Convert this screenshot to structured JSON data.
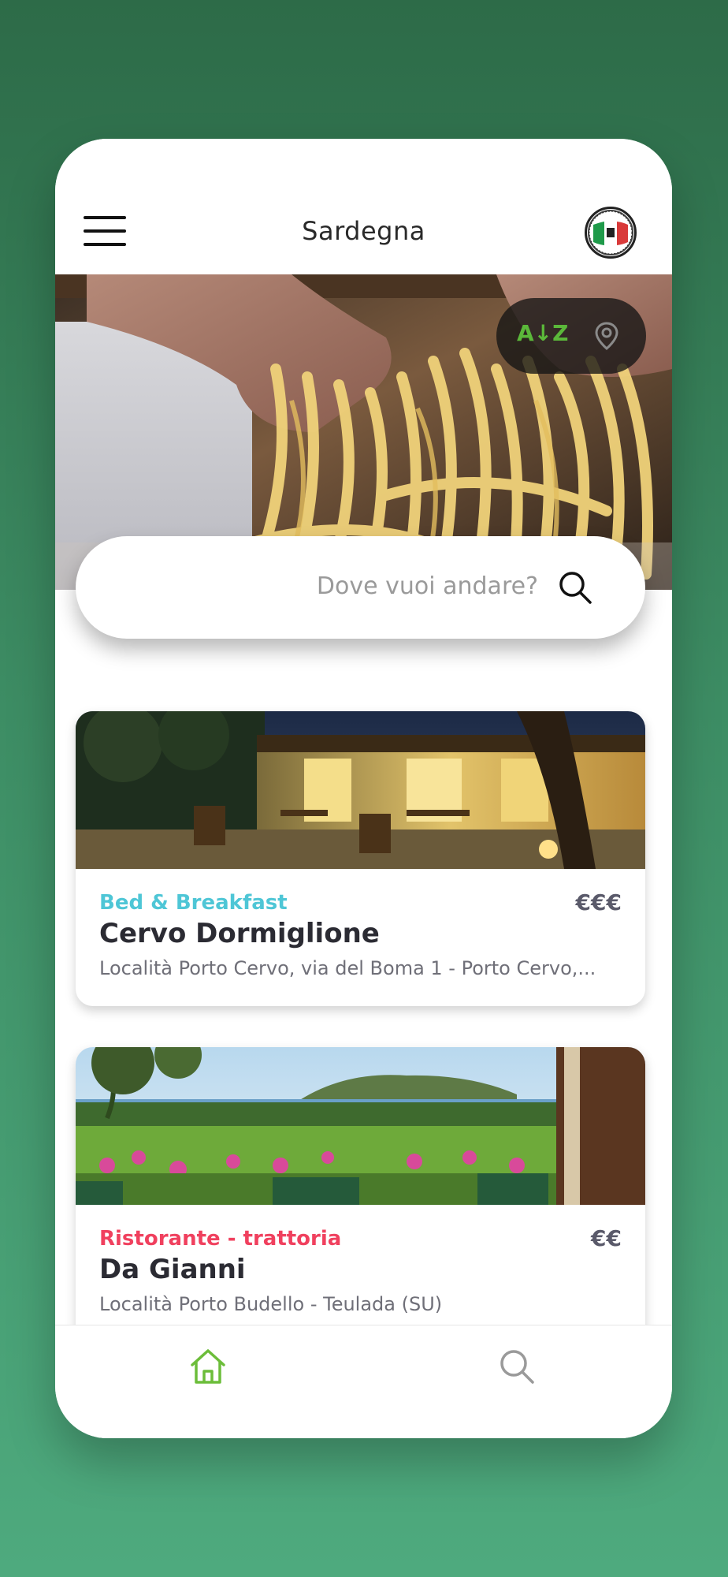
{
  "header": {
    "title": "Sardegna"
  },
  "hero": {
    "sort_az_label": "A↓Z",
    "sort_icons": [
      "sort-alpha-icon",
      "location-pin-icon"
    ]
  },
  "search": {
    "placeholder": "Dove vuoi andare?"
  },
  "cards": [
    {
      "category": "Bed & Breakfast",
      "category_color": "#4ec6d6",
      "price": "€€€",
      "name": "Cervo Dormiglione",
      "address": "Località Porto Cervo, via del Boma 1 - Porto Cervo,..."
    },
    {
      "category": "Ristorante - trattoria",
      "category_color": "#f0405e",
      "price": "€€",
      "name": "Da Gianni",
      "address": "Località Porto Budello - Teulada (SU)"
    }
  ],
  "bottom_nav": {
    "items": [
      "home-icon",
      "search-icon"
    ],
    "active_color": "#6cbd3a"
  },
  "colors": {
    "background": "#3d8d64",
    "accent_green": "#5bb83a"
  }
}
